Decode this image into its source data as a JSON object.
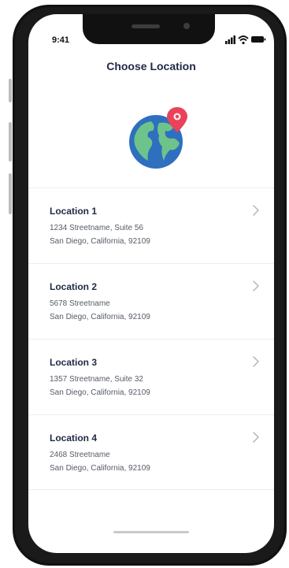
{
  "status_bar": {
    "time": "9:41",
    "icons": [
      "signal-icon",
      "wifi-icon",
      "battery-icon"
    ]
  },
  "header": {
    "title": "Choose Location"
  },
  "hero": {
    "icon": "globe-with-pin-icon",
    "colors": {
      "ocean": "#2f6fbf",
      "land": "#6ec38a",
      "pin": "#e8435a"
    }
  },
  "locations": [
    {
      "name": "Location 1",
      "line1": "1234 Streetname, Suite 56",
      "line2": "San Diego, California, 92109"
    },
    {
      "name": "Location 2",
      "line1": "5678 Streetname",
      "line2": "San Diego, California, 92109"
    },
    {
      "name": "Location 3",
      "line1": "1357 Streetname, Suite 32",
      "line2": "San Diego, California, 92109"
    },
    {
      "name": "Location 4",
      "line1": "2468 Streetname",
      "line2": "San Diego, California, 92109"
    }
  ],
  "theme": {
    "title_color": "#1f2a44",
    "text_color": "#555b66",
    "divider_color": "#ececec",
    "chevron_color": "#b5b5b5"
  }
}
